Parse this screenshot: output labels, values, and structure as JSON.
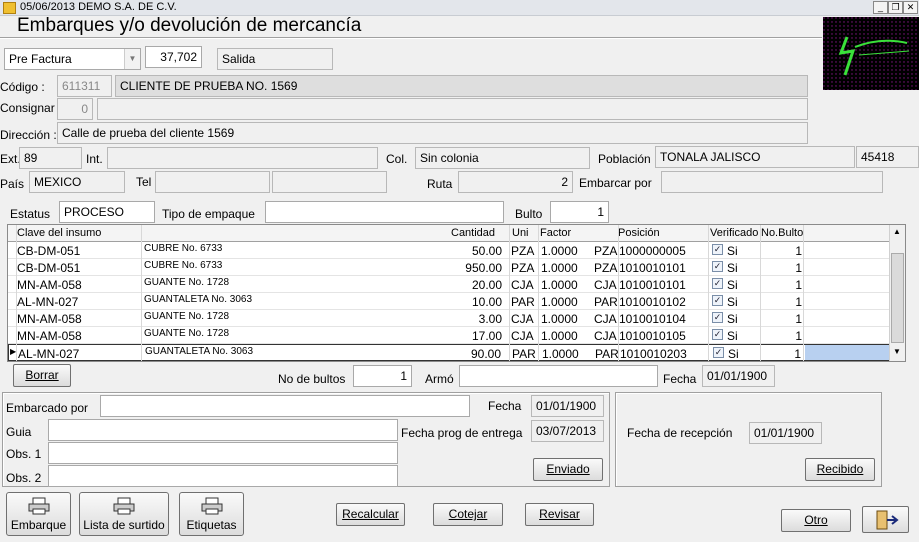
{
  "window": {
    "title": "05/06/2013  DEMO  S.A. DE C.V."
  },
  "header": {
    "title": "Embarques y/o devolución de mercancía"
  },
  "top": {
    "doc_type": "Pre Factura",
    "number": "37,702",
    "movement": "Salida"
  },
  "client": {
    "codigo_label": "Código :",
    "codigo": "611311",
    "nombre": "CLIENTE DE PRUEBA NO. 1569",
    "consignar_label": "Consignar",
    "consignar": "0",
    "consignar_name": "",
    "direccion_label": "Dirección :",
    "direccion": "Calle de prueba del cliente 1569",
    "ext_label": "Ext.",
    "ext": "89",
    "int_label": "Int.",
    "int": "",
    "col_label": "Col.",
    "colonia": "Sin colonia",
    "poblacion_label": "Población",
    "poblacion": "TONALA  JALISCO",
    "cp": "45418",
    "pais_label": "País",
    "pais": "MEXICO",
    "tel_label": "Tel",
    "tel1": "",
    "tel2": "",
    "ruta_label": "Ruta",
    "ruta": "2",
    "embarcar_label": "Embarcar por",
    "embarcar": ""
  },
  "status": {
    "estatus_label": "Estatus",
    "estatus": "PROCESO",
    "tipo_label": "Tipo de empaque",
    "tipo": "",
    "bulto_label": "Bulto",
    "bulto": "1"
  },
  "grid": {
    "headers": {
      "clave": "Clave del insumo",
      "cantidad": "Cantidad",
      "uni": "Uni",
      "factor": "Factor",
      "posicion": "Posición",
      "verificado": "Verificado",
      "nobulto": "No.Bulto"
    },
    "rows": [
      {
        "clave": "CB-DM-051",
        "desc": "CUBRE No. 6733",
        "cantidad": "50.00",
        "uni": "PZA",
        "factor": "1.0000",
        "uni2": "PZA",
        "posicion": "1000000005",
        "verif": "Si",
        "bulto": "1"
      },
      {
        "clave": "CB-DM-051",
        "desc": "CUBRE No. 6733",
        "cantidad": "950.00",
        "uni": "PZA",
        "factor": "1.0000",
        "uni2": "PZA",
        "posicion": "1010010101",
        "verif": "Si",
        "bulto": "1"
      },
      {
        "clave": "MN-AM-058",
        "desc": "GUANTE No. 1728",
        "cantidad": "20.00",
        "uni": "CJA",
        "factor": "1.0000",
        "uni2": "CJA",
        "posicion": "1010010101",
        "verif": "Si",
        "bulto": "1"
      },
      {
        "clave": "AL-MN-027",
        "desc": "GUANTALETA No. 3063",
        "cantidad": "10.00",
        "uni": "PAR",
        "factor": "1.0000",
        "uni2": "PAR",
        "posicion": "1010010102",
        "verif": "Si",
        "bulto": "1"
      },
      {
        "clave": "MN-AM-058",
        "desc": "GUANTE No. 1728",
        "cantidad": "3.00",
        "uni": "CJA",
        "factor": "1.0000",
        "uni2": "CJA",
        "posicion": "1010010104",
        "verif": "Si",
        "bulto": "1"
      },
      {
        "clave": "MN-AM-058",
        "desc": "GUANTE No. 1728",
        "cantidad": "17.00",
        "uni": "CJA",
        "factor": "1.0000",
        "uni2": "CJA",
        "posicion": "1010010105",
        "verif": "Si",
        "bulto": "1"
      },
      {
        "clave": "AL-MN-027",
        "desc": "GUANTALETA No. 3063",
        "cantidad": "90.00",
        "uni": "PAR",
        "factor": "1.0000",
        "uni2": "PAR",
        "posicion": "1010010203",
        "verif": "Si",
        "bulto": "1"
      }
    ]
  },
  "under": {
    "borrar": "Borrar",
    "nobultos_label": "No de bultos",
    "nobultos": "1",
    "armo_label": "Armó",
    "armo": "",
    "fecha_label": "Fecha",
    "fecha": "01/01/1900"
  },
  "ship": {
    "embarcado_label": "Embarcado por",
    "embarcado": "",
    "fecha_label": "Fecha",
    "fecha": "01/01/1900",
    "guia_label": "Guia",
    "guia": "",
    "fprog_label": "Fecha prog de entrega",
    "fprog": "03/07/2013",
    "obs1_label": "Obs. 1",
    "obs1": "",
    "obs2_label": "Obs. 2",
    "obs2": "",
    "enviado": "Enviado"
  },
  "recv": {
    "label": "Fecha de recepción",
    "fecha": "01/01/1900",
    "recibido": "Recibido"
  },
  "footer": {
    "embarque": "Embarque",
    "lista": "Lista de surtido",
    "etiquetas": "Etiquetas",
    "recalcular": "Recalcular",
    "cotejar": "Cotejar",
    "revisar": "Revisar",
    "otro": "Otro"
  },
  "icons": {
    "app": "app-icon",
    "print": "printer-icon",
    "exit": "exit-door-icon"
  }
}
